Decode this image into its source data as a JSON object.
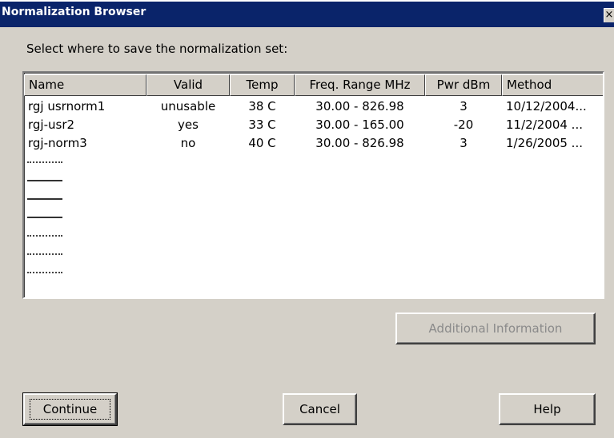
{
  "window": {
    "title": "Normalization Browser",
    "close_label": "×"
  },
  "prompt": "Select where to save the normalization set:",
  "columns": [
    "Name",
    "Valid",
    "Temp",
    "Freq. Range MHz",
    "Pwr dBm",
    "Method"
  ],
  "rows": [
    {
      "name": "rgj usrnorm1",
      "valid": "unusable",
      "temp": "38 C",
      "freq": "30.00 - 826.98",
      "pwr": "3",
      "method": "10/12/2004..."
    },
    {
      "name": "rgj-usr2",
      "valid": "yes",
      "temp": "33 C",
      "freq": "30.00 - 165.00",
      "pwr": "-20",
      "method": "11/2/2004 ..."
    },
    {
      "name": "rgj-norm3",
      "valid": "no",
      "temp": "40 C",
      "freq": "30.00 - 826.98",
      "pwr": "3",
      "method": "1/26/2005 ..."
    }
  ],
  "empty_slots": 7,
  "buttons": {
    "additional_info": "Additional Information",
    "continue": "Continue",
    "cancel": "Cancel",
    "help": "Help"
  },
  "colors": {
    "titlebar": "#0a246a",
    "face": "#d4d0c8",
    "disabled_text": "#8a8a8a"
  }
}
